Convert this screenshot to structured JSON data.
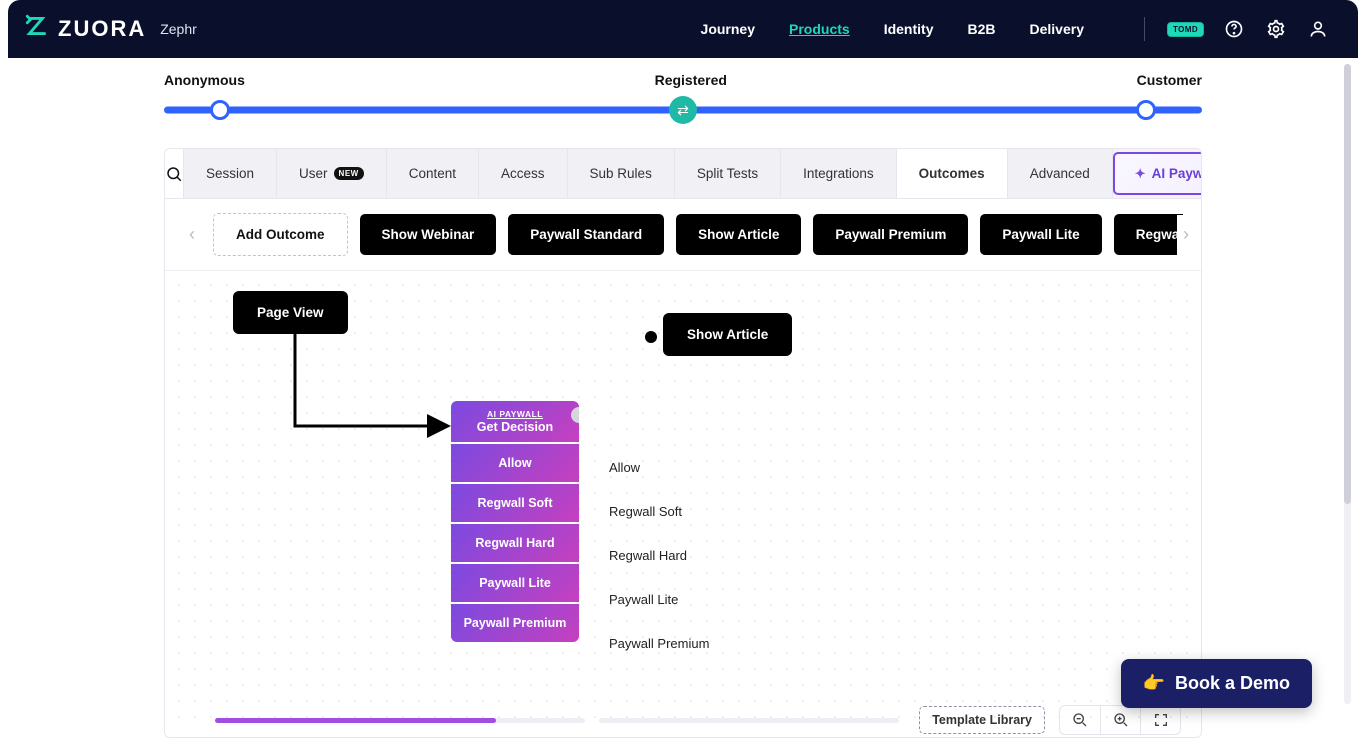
{
  "header": {
    "brand": "ZUORA",
    "sub": "Zephr",
    "nav": {
      "journey": "Journey",
      "products": "Products",
      "identity": "Identity",
      "b2b": "B2B",
      "delivery": "Delivery"
    },
    "pill": "TOMD"
  },
  "journey": {
    "a": "Anonymous",
    "b": "Registered",
    "c": "Customer"
  },
  "tabs": {
    "session": "Session",
    "user": "User",
    "user_badge": "NEW",
    "content": "Content",
    "access": "Access",
    "subrules": "Sub Rules",
    "split": "Split Tests",
    "integrations": "Integrations",
    "outcomes": "Outcomes",
    "advanced": "Advanced",
    "ai": "AI Paywall"
  },
  "outcomes": {
    "add": "Add Outcome",
    "chips": [
      "Show Webinar",
      "Paywall Standard",
      "Show Article",
      "Paywall Premium",
      "Paywall Lite",
      "Regwall Hard"
    ]
  },
  "nodes": {
    "pageview": "Page View",
    "showarticle": "Show Article",
    "ai_caption": "AI PAYWALL",
    "ai_title": "Get Decision",
    "opts": [
      "Allow",
      "Regwall Soft",
      "Regwall Hard",
      "Paywall Lite",
      "Paywall Premium"
    ]
  },
  "footer": {
    "template": "Template Library"
  },
  "cta": "Book a Demo"
}
